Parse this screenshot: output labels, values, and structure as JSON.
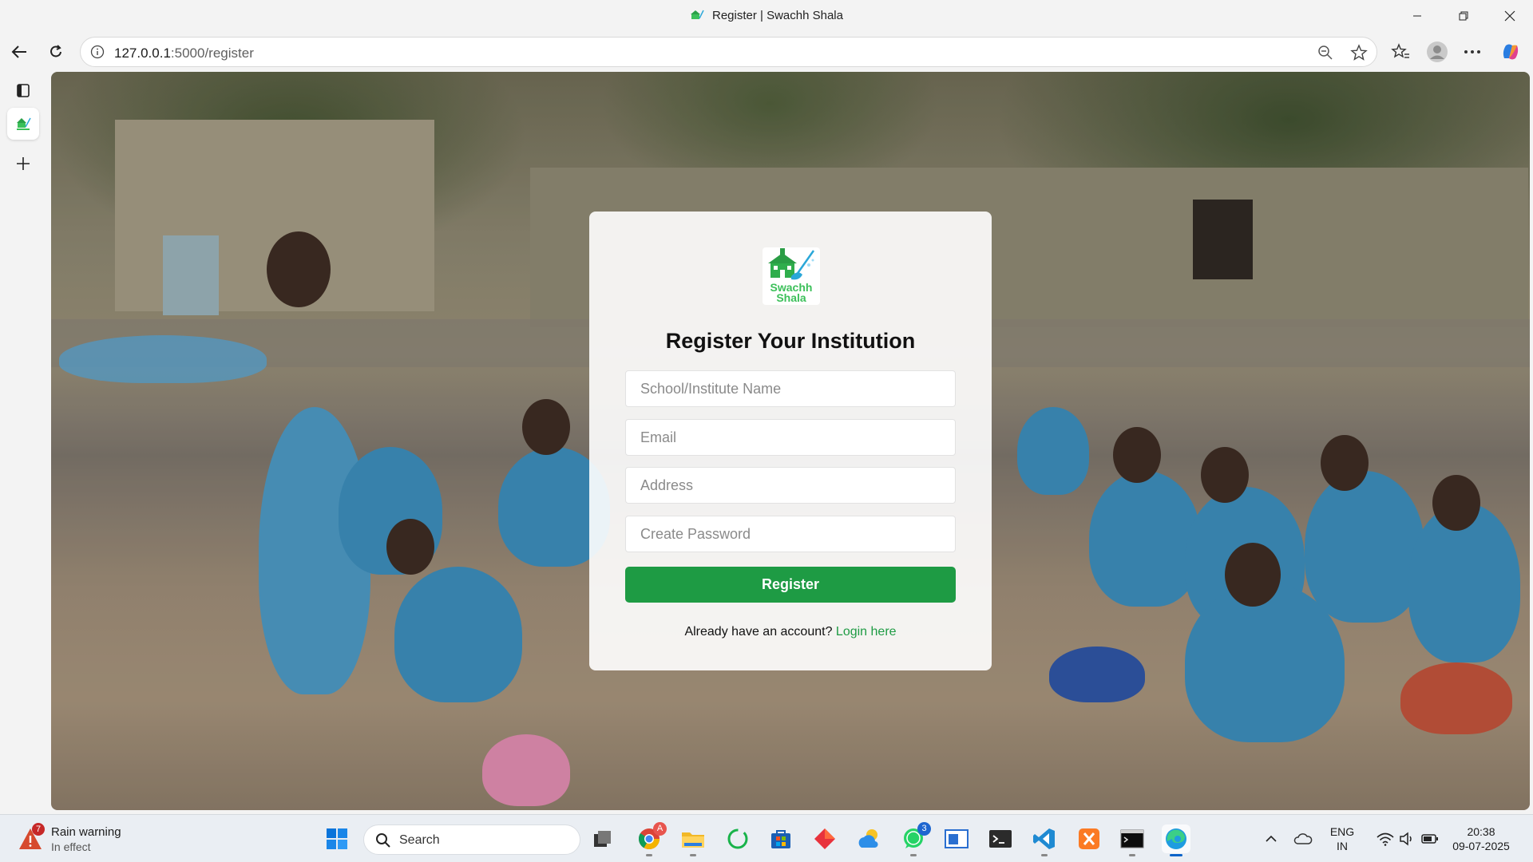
{
  "window": {
    "title": "Register | Swachh Shala"
  },
  "browser": {
    "url_host": "127.0.0.1",
    "url_path": ":5000/register"
  },
  "form": {
    "logo_line1": "Swachh",
    "logo_line2": "Shala",
    "heading": "Register Your Institution",
    "fields": [
      {
        "placeholder": "School/Institute Name",
        "value": ""
      },
      {
        "placeholder": "Email",
        "value": ""
      },
      {
        "placeholder": "Address",
        "value": ""
      },
      {
        "placeholder": "Create Password",
        "value": ""
      }
    ],
    "submit_label": "Register",
    "account_prompt": "Already have an account?",
    "login_link": "Login here"
  },
  "taskbar": {
    "weather_title": "Rain warning",
    "weather_sub": "In effect",
    "weather_badge": "7",
    "search_label": "Search",
    "chrome_badge": "A",
    "whatsapp_badge": "3",
    "lang_line1": "ENG",
    "lang_line2": "IN",
    "time": "20:38",
    "date": "09-07-2025"
  },
  "colors": {
    "brand_green": "#1e9b44",
    "logo_green": "#3cc05a",
    "accent_blue": "#0a63c9"
  }
}
